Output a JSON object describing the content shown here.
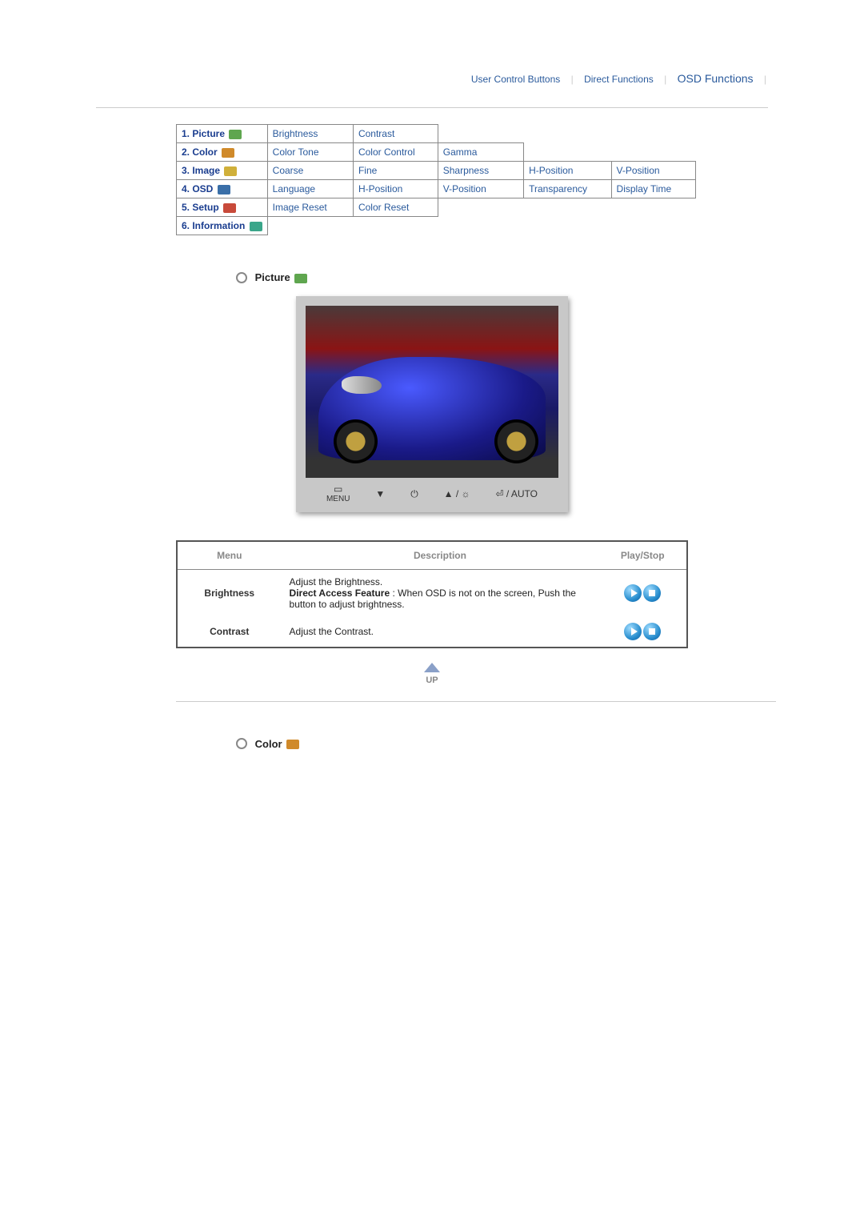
{
  "nav": {
    "user_buttons": "User Control Buttons",
    "direct_functions": "Direct Functions",
    "osd_functions": "OSD Functions"
  },
  "index": {
    "rows": [
      {
        "head": "1. Picture",
        "icon": "badge-green",
        "cells": [
          "Brightness",
          "Contrast",
          "",
          "",
          ""
        ]
      },
      {
        "head": "2. Color",
        "icon": "badge-orange",
        "cells": [
          "Color Tone",
          "Color Control",
          "Gamma",
          "",
          ""
        ]
      },
      {
        "head": "3. Image",
        "icon": "badge-yellow",
        "cells": [
          "Coarse",
          "Fine",
          "Sharpness",
          "H-Position",
          "V-Position"
        ]
      },
      {
        "head": "4. OSD",
        "icon": "badge-blue",
        "cells": [
          "Language",
          "H-Position",
          "V-Position",
          "Transparency",
          "Display Time"
        ]
      },
      {
        "head": "5. Setup",
        "icon": "badge-red",
        "cells": [
          "Image Reset",
          "Color Reset",
          "",
          "",
          ""
        ]
      },
      {
        "head": "6. Information",
        "icon": "badge-teal",
        "cells": [
          "",
          "",
          "",
          "",
          ""
        ]
      }
    ]
  },
  "section_picture": {
    "title": "Picture"
  },
  "monitor_controls": {
    "menu": "MENU",
    "down": "▼",
    "power": "⏻",
    "up_bright": "▲ / ☼",
    "enter_auto": "⏎ / AUTO"
  },
  "desc_table": {
    "headers": {
      "menu": "Menu",
      "desc": "Description",
      "play": "Play/Stop"
    },
    "rows": [
      {
        "menu": "Brightness",
        "desc_line1": "Adjust the Brightness.",
        "desc_bold": "Direct Access Feature",
        "desc_rest": " : When OSD is not on the screen, Push the button to adjust brightness."
      },
      {
        "menu": "Contrast",
        "desc_line1": "Adjust the Contrast.",
        "desc_bold": "",
        "desc_rest": ""
      }
    ]
  },
  "up_label": "UP",
  "section_color": {
    "title": "Color"
  }
}
